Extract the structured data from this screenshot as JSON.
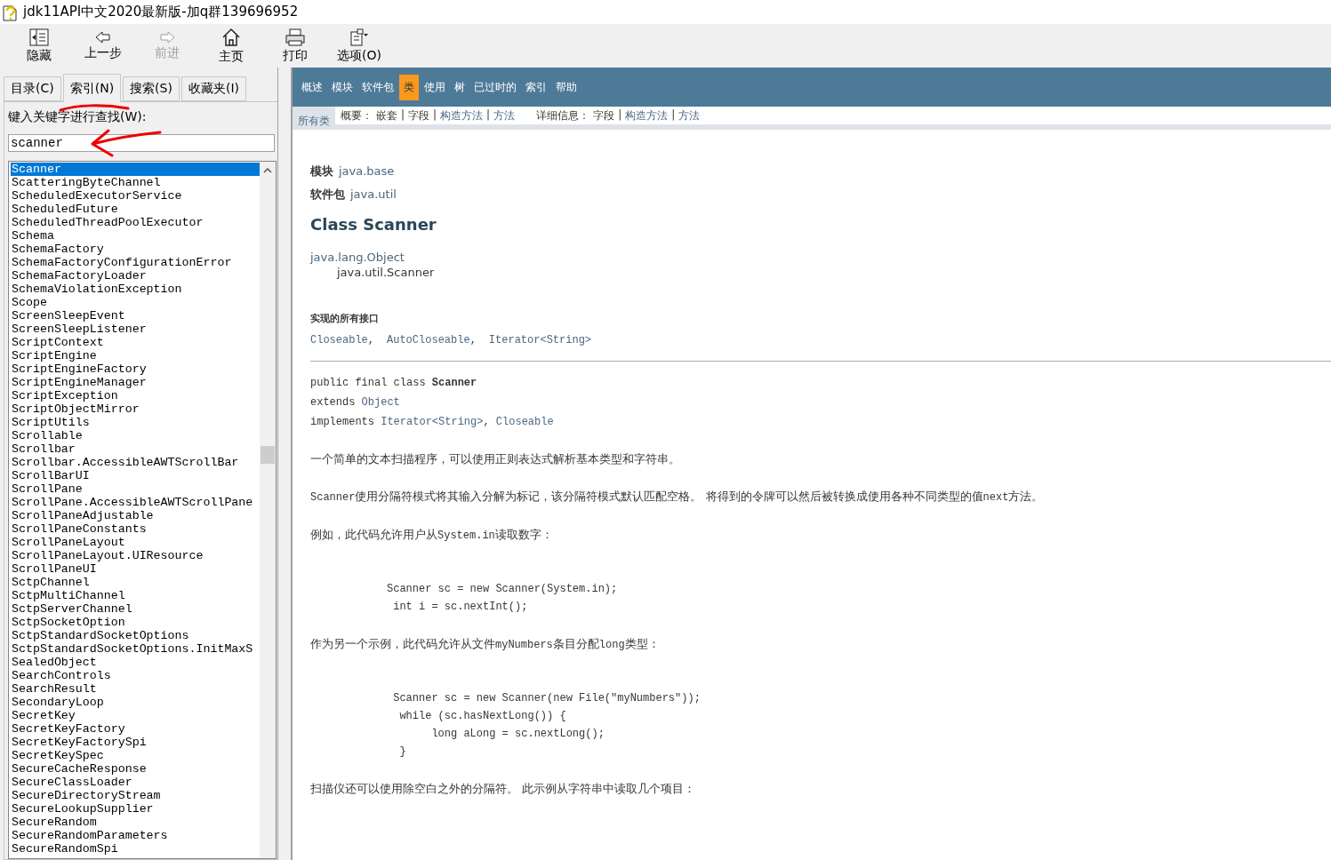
{
  "window": {
    "title": "jdk11API中文2020最新版-加q群139696952"
  },
  "toolbar": [
    {
      "label": "隐藏",
      "disabled": false
    },
    {
      "label": "上一步",
      "disabled": false
    },
    {
      "label": "前进",
      "disabled": true
    },
    {
      "label": "主页",
      "disabled": false
    },
    {
      "label": "打印",
      "disabled": false
    },
    {
      "label": "选项(O)",
      "disabled": false
    }
  ],
  "tabs": [
    {
      "label": "目录(C)",
      "selected": false
    },
    {
      "label": "索引(N)",
      "selected": true
    },
    {
      "label": "搜索(S)",
      "selected": false
    },
    {
      "label": "收藏夹(I)",
      "selected": false
    }
  ],
  "index_panel": {
    "label": "键入关键字进行查找(W):",
    "query": "scanner",
    "items": [
      {
        "name": "Scanner",
        "selected": true
      },
      {
        "name": "ScatteringByteChannel",
        "selected": false
      },
      {
        "name": "ScheduledExecutorService",
        "selected": false
      },
      {
        "name": "ScheduledFuture",
        "selected": false
      },
      {
        "name": "ScheduledThreadPoolExecutor",
        "selected": false
      },
      {
        "name": "Schema",
        "selected": false
      },
      {
        "name": "SchemaFactory",
        "selected": false
      },
      {
        "name": "SchemaFactoryConfigurationError",
        "selected": false
      },
      {
        "name": "SchemaFactoryLoader",
        "selected": false
      },
      {
        "name": "SchemaViolationException",
        "selected": false
      },
      {
        "name": "Scope",
        "selected": false
      },
      {
        "name": "ScreenSleepEvent",
        "selected": false
      },
      {
        "name": "ScreenSleepListener",
        "selected": false
      },
      {
        "name": "ScriptContext",
        "selected": false
      },
      {
        "name": "ScriptEngine",
        "selected": false
      },
      {
        "name": "ScriptEngineFactory",
        "selected": false
      },
      {
        "name": "ScriptEngineManager",
        "selected": false
      },
      {
        "name": "ScriptException",
        "selected": false
      },
      {
        "name": "ScriptObjectMirror",
        "selected": false
      },
      {
        "name": "ScriptUtils",
        "selected": false
      },
      {
        "name": "Scrollable",
        "selected": false
      },
      {
        "name": "Scrollbar",
        "selected": false
      },
      {
        "name": "Scrollbar.AccessibleAWTScrollBar",
        "selected": false
      },
      {
        "name": "ScrollBarUI",
        "selected": false
      },
      {
        "name": "ScrollPane",
        "selected": false
      },
      {
        "name": "ScrollPane.AccessibleAWTScrollPane",
        "selected": false
      },
      {
        "name": "ScrollPaneAdjustable",
        "selected": false
      },
      {
        "name": "ScrollPaneConstants",
        "selected": false
      },
      {
        "name": "ScrollPaneLayout",
        "selected": false
      },
      {
        "name": "ScrollPaneLayout.UIResource",
        "selected": false
      },
      {
        "name": "ScrollPaneUI",
        "selected": false
      },
      {
        "name": "SctpChannel",
        "selected": false
      },
      {
        "name": "SctpMultiChannel",
        "selected": false
      },
      {
        "name": "SctpServerChannel",
        "selected": false
      },
      {
        "name": "SctpSocketOption",
        "selected": false
      },
      {
        "name": "SctpStandardSocketOptions",
        "selected": false
      },
      {
        "name": "SctpStandardSocketOptions.InitMaxS",
        "selected": false
      },
      {
        "name": "SealedObject",
        "selected": false
      },
      {
        "name": "SearchControls",
        "selected": false
      },
      {
        "name": "SearchResult",
        "selected": false
      },
      {
        "name": "SecondaryLoop",
        "selected": false
      },
      {
        "name": "SecretKey",
        "selected": false
      },
      {
        "name": "SecretKeyFactory",
        "selected": false
      },
      {
        "name": "SecretKeyFactorySpi",
        "selected": false
      },
      {
        "name": "SecretKeySpec",
        "selected": false
      },
      {
        "name": "SecureCacheResponse",
        "selected": false
      },
      {
        "name": "SecureClassLoader",
        "selected": false
      },
      {
        "name": "SecureDirectoryStream",
        "selected": false
      },
      {
        "name": "SecureLookupSupplier",
        "selected": false
      },
      {
        "name": "SecureRandom",
        "selected": false
      },
      {
        "name": "SecureRandomParameters",
        "selected": false
      },
      {
        "name": "SecureRandomSpi",
        "selected": false
      }
    ]
  },
  "doc": {
    "nav": [
      {
        "label": "概述",
        "selected": false
      },
      {
        "label": "模块",
        "selected": false
      },
      {
        "label": "软件包",
        "selected": false
      },
      {
        "label": "类",
        "selected": true
      },
      {
        "label": "使用",
        "selected": false
      },
      {
        "label": "树",
        "selected": false
      },
      {
        "label": "已过时的",
        "selected": false
      },
      {
        "label": "索引",
        "selected": false
      },
      {
        "label": "帮助",
        "selected": false
      }
    ],
    "all_classes": "所有类",
    "separator": "|",
    "summary": {
      "label": "概要：",
      "links": [
        {
          "text": "嵌套",
          "link": false
        },
        {
          "text": "字段",
          "link": false
        },
        {
          "text": "构造方法",
          "link": true
        },
        {
          "text": "方法",
          "link": true
        }
      ]
    },
    "detail": {
      "label": "详细信息：",
      "links": [
        {
          "text": "字段",
          "link": false
        },
        {
          "text": "构造方法",
          "link": true
        },
        {
          "text": "方法",
          "link": true
        }
      ]
    },
    "module_label": "模块",
    "module": "java.base",
    "package_label": "软件包",
    "package": "java.util",
    "title": "Class Scanner",
    "hierarchy": [
      "java.lang.Object",
      "java.util.Scanner"
    ],
    "interfaces_heading": "实现的所有接口",
    "interfaces": [
      "Closeable",
      "AutoCloseable",
      "Iterator<String>"
    ],
    "interfaces_separator": ",",
    "signature": [
      [
        {
          "text": "public final class ",
          "kind": "plain"
        },
        {
          "text": "Scanner",
          "kind": "bold"
        }
      ],
      [
        {
          "text": "extends ",
          "kind": "plain"
        },
        {
          "text": "Object",
          "kind": "link"
        }
      ],
      [
        {
          "text": "implements ",
          "kind": "plain"
        },
        {
          "text": "Iterator<String>",
          "kind": "link"
        },
        {
          "text": ", ",
          "kind": "plain"
        },
        {
          "text": "Closeable",
          "kind": "link"
        }
      ]
    ],
    "body": [
      {
        "kind": "paragraph",
        "segments": [
          {
            "text": "一个简单的文本扫描程序，可以使用正则表达式解析基本类型和字符串。",
            "kind": "text"
          }
        ]
      },
      {
        "kind": "paragraph",
        "segments": [
          {
            "text": "Scanner",
            "kind": "code"
          },
          {
            "text": "使用分隔符模式将其输入分解为标记，该分隔符模式默认匹配空格。 将得到的令牌可以然后被转换成使用各种不同类型的值",
            "kind": "text"
          },
          {
            "text": "next",
            "kind": "code"
          },
          {
            "text": "方法。",
            "kind": "text"
          }
        ]
      },
      {
        "kind": "paragraph",
        "segments": [
          {
            "text": "例如，此代码允许用户从",
            "kind": "text"
          },
          {
            "text": "System.in",
            "kind": "code"
          },
          {
            "text": "读取数字：",
            "kind": "text"
          }
        ]
      },
      {
        "kind": "code",
        "lines": [
          "Scanner sc = new Scanner(System.in);",
          " int i = sc.nextInt();"
        ]
      },
      {
        "kind": "paragraph",
        "segments": [
          {
            "text": "作为另一个示例，此代码允许从文件",
            "kind": "text"
          },
          {
            "text": "myNumbers",
            "kind": "code"
          },
          {
            "text": "条目分配",
            "kind": "text"
          },
          {
            "text": "long",
            "kind": "code"
          },
          {
            "text": "类型：",
            "kind": "text"
          }
        ]
      },
      {
        "kind": "code",
        "lines": [
          " Scanner sc = new Scanner(new File(\"myNumbers\"));",
          "  while (sc.hasNextLong()) {",
          "       long aLong = sc.nextLong();",
          "  }"
        ]
      },
      {
        "kind": "paragraph",
        "segments": [
          {
            "text": "扫描仪还可以使用除空白之外的分隔符。 此示例从字符串中读取几个项目：",
            "kind": "text"
          }
        ]
      }
    ]
  }
}
